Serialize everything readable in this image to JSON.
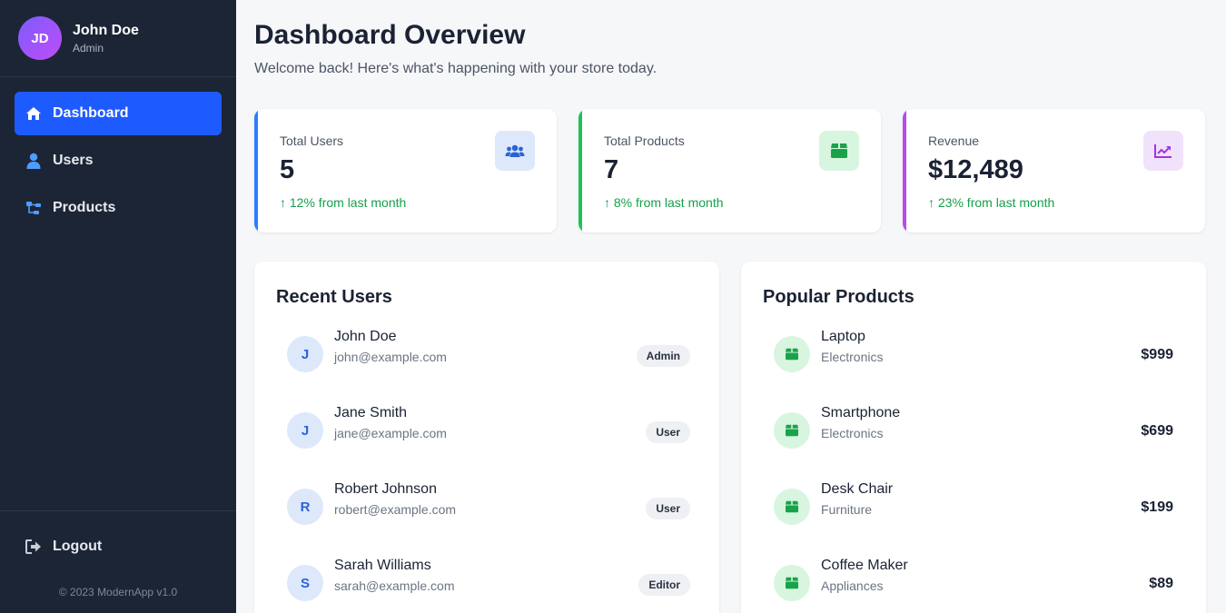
{
  "profile": {
    "initials": "JD",
    "name": "John Doe",
    "role": "Admin"
  },
  "nav": {
    "items": [
      {
        "label": "Dashboard",
        "icon": "home-icon",
        "active": true
      },
      {
        "label": "Users",
        "icon": "user-icon",
        "active": false
      },
      {
        "label": "Products",
        "icon": "sitemap-icon",
        "active": false
      }
    ],
    "logout_label": "Logout",
    "copyright": "© 2023 ModernApp v1.0"
  },
  "header": {
    "title": "Dashboard Overview",
    "subtitle": "Welcome back! Here's what's happening with your store today."
  },
  "stats": [
    {
      "label": "Total Users",
      "value": "5",
      "change": "↑ 12% from last month",
      "icon": "users-icon",
      "accent": "#2f7cff",
      "icon_bg": "#dde8fb",
      "icon_color": "#2a63d6"
    },
    {
      "label": "Total Products",
      "value": "7",
      "change": "↑ 8% from last month",
      "icon": "box-icon",
      "accent": "#1fc15a",
      "icon_bg": "#d8f5e0",
      "icon_color": "#18a34a"
    },
    {
      "label": "Revenue",
      "value": "$12,489",
      "change": "↑ 23% from last month",
      "icon": "chart-line-icon",
      "accent": "#b44cf0",
      "icon_bg": "#f1e2fb",
      "icon_color": "#a334e0"
    }
  ],
  "recent_users": {
    "title": "Recent Users",
    "rows": [
      {
        "initial": "J",
        "name": "John Doe",
        "email": "john@example.com",
        "role": "Admin"
      },
      {
        "initial": "J",
        "name": "Jane Smith",
        "email": "jane@example.com",
        "role": "User"
      },
      {
        "initial": "R",
        "name": "Robert Johnson",
        "email": "robert@example.com",
        "role": "User"
      },
      {
        "initial": "S",
        "name": "Sarah Williams",
        "email": "sarah@example.com",
        "role": "Editor"
      }
    ]
  },
  "popular_products": {
    "title": "Popular Products",
    "rows": [
      {
        "name": "Laptop",
        "category": "Electronics",
        "price": "$999",
        "icon": "box-icon"
      },
      {
        "name": "Smartphone",
        "category": "Electronics",
        "price": "$699",
        "icon": "box-icon"
      },
      {
        "name": "Desk Chair",
        "category": "Furniture",
        "price": "$199",
        "icon": "box-icon"
      },
      {
        "name": "Coffee Maker",
        "category": "Appliances",
        "price": "$89",
        "icon": "box-icon"
      }
    ]
  },
  "colors": {
    "sidebar_bg": "#1c2536",
    "active_nav": "#1e5bff",
    "nav_icon": "#4f9cff",
    "positive": "#15a04a"
  }
}
